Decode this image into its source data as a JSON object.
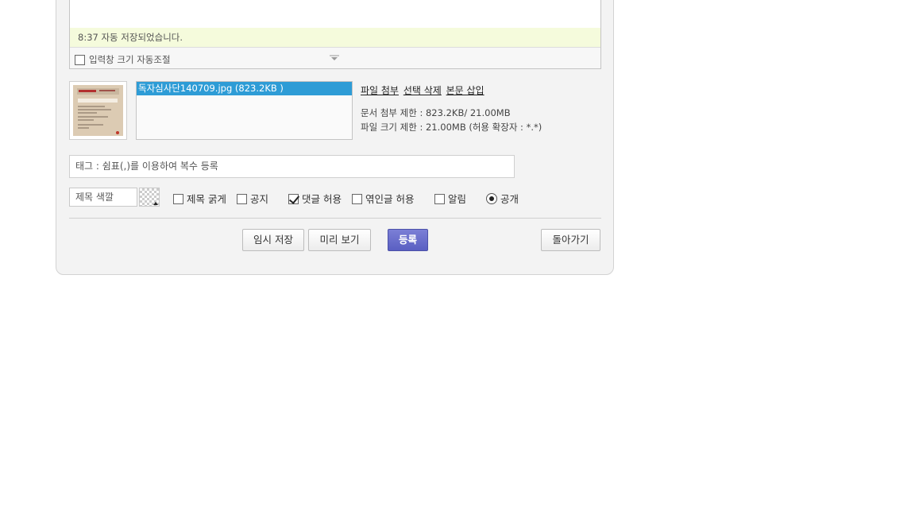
{
  "editor": {
    "autosave_status": "8:37 자동 저장되었습니다.",
    "auto_resize_label": "입력창 크기 자동조절",
    "auto_resize_checked": false
  },
  "attachments": {
    "files": [
      {
        "name": "독자심사단140709.jpg (823.2KB )",
        "selected": true
      }
    ],
    "links": {
      "attach": "파일 첨부",
      "delete_selected": "선택 삭제",
      "insert_body": "본문 삽입"
    },
    "doc_limit": "문서 첨부 제한 : 823.2KB/ 21.00MB",
    "file_limit": "파일 크기 제한 : 21.00MB (허용 확장자 : *.*)"
  },
  "tags": {
    "placeholder": "태그 : 쉼표(,)를 이용하여 복수 등록"
  },
  "options": {
    "title_color_placeholder": "제목 색깔",
    "bold_title": {
      "label": "제목 굵게",
      "checked": false
    },
    "notice": {
      "label": "공지",
      "checked": false
    },
    "allow_comments": {
      "label": "댓글 허용",
      "checked": true
    },
    "allow_trackback": {
      "label": "엮인글 허용",
      "checked": false
    },
    "notify": {
      "label": "알림",
      "checked": false
    },
    "public": {
      "label": "공개",
      "selected": true
    }
  },
  "buttons": {
    "temp_save": "임시 저장",
    "preview": "미리 보기",
    "submit": "등록",
    "back": "돌아가기"
  },
  "colors": {
    "submit_button": "#5a5fc2",
    "autosave_bg": "#f5fbdc",
    "selected_file": "#2e9cd6"
  }
}
